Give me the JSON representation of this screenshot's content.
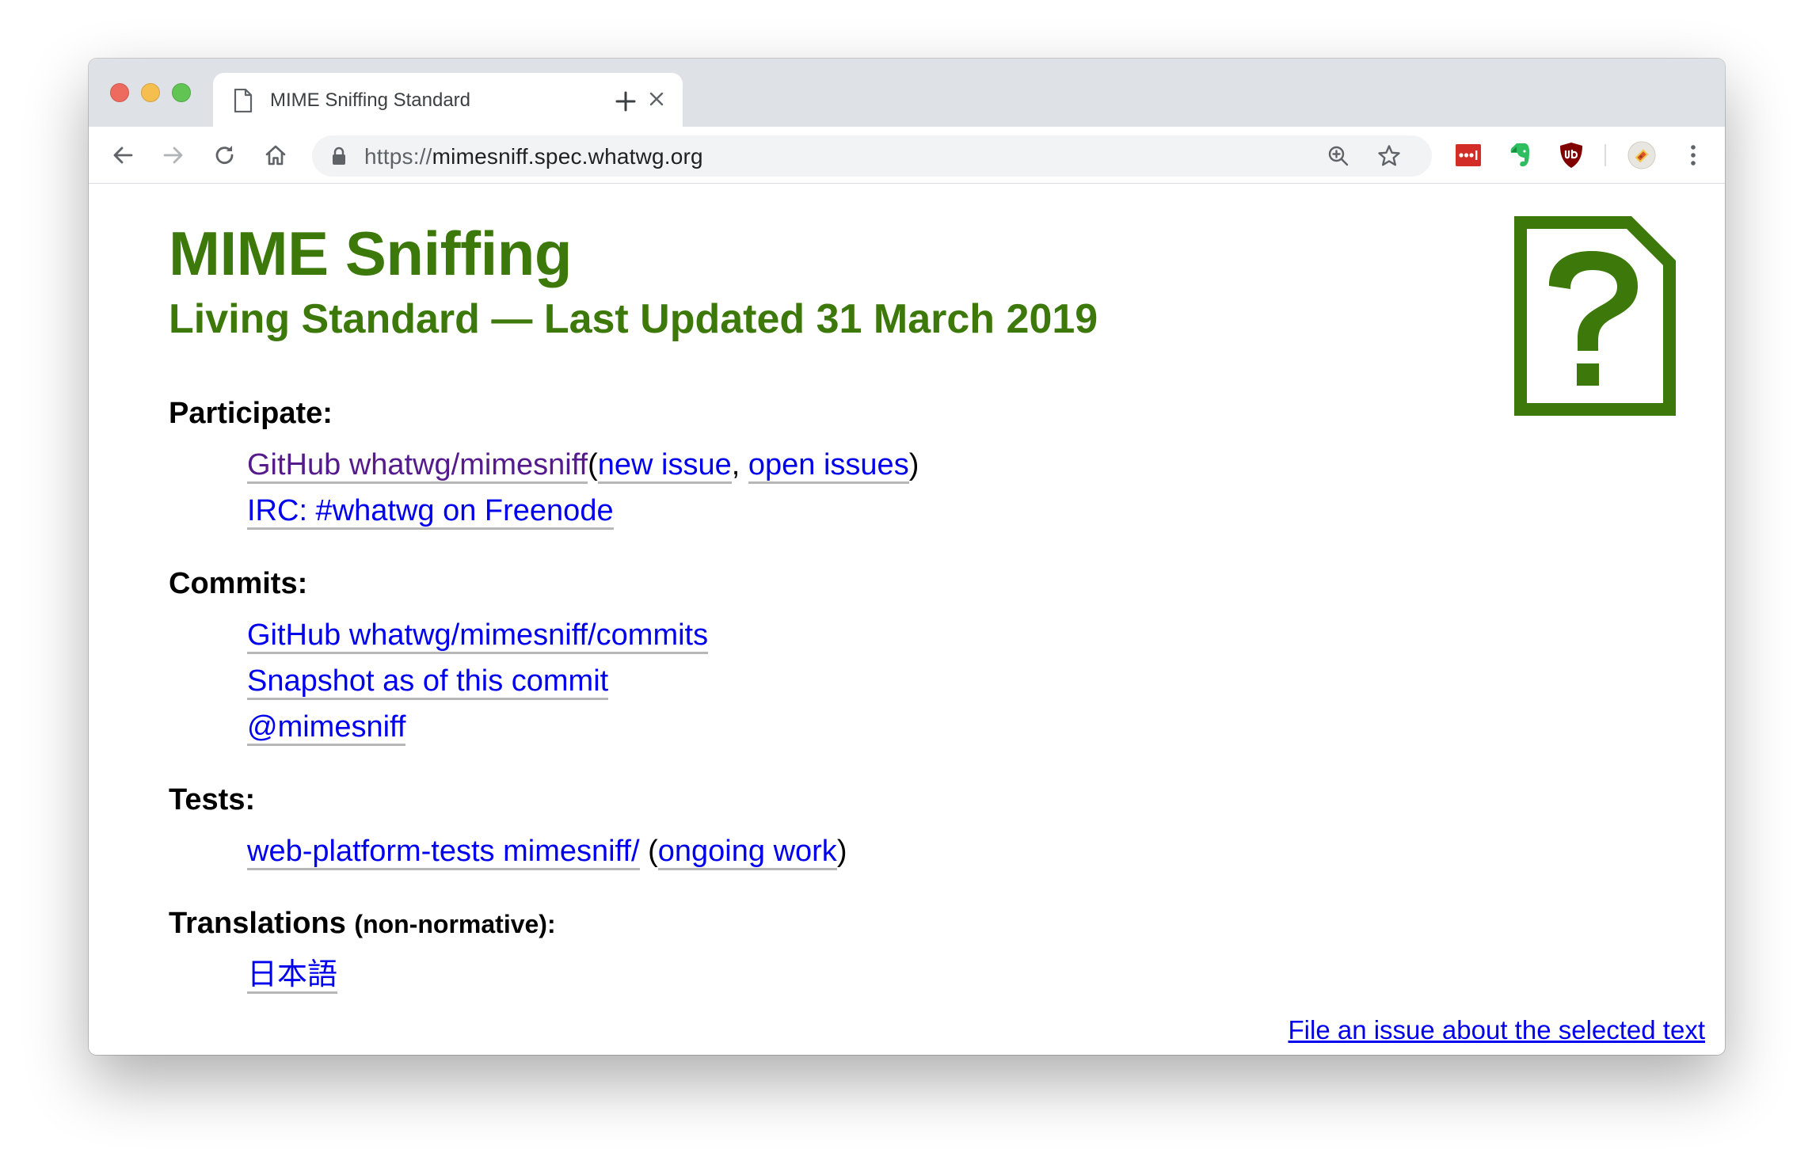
{
  "browser": {
    "tab": {
      "title": "MIME Sniffing Standard"
    },
    "address_bar": {
      "scheme": "https://",
      "host": "mimesniff.spec.whatwg.org"
    },
    "colors": {
      "tabstrip": "#dee1e6",
      "lastpass": "#d32d27",
      "evernote": "#2dbe60",
      "ublock": "#800000"
    }
  },
  "page": {
    "title": "MIME Sniffing",
    "subtitle": "Living Standard — Last Updated 31 March 2019",
    "accent_color": "#3c790a",
    "participate": {
      "heading": "Participate:",
      "github": "GitHub whatwg/mimesniff",
      "open_paren": "(",
      "new_issue": "new issue",
      "comma": ", ",
      "open_issues": "open issues",
      "close_paren": ")",
      "irc": "IRC: #whatwg on Freenode"
    },
    "commits": {
      "heading": "Commits:",
      "github_commits": "GitHub whatwg/mimesniff/commits",
      "snapshot": "Snapshot as of this commit",
      "twitter": "@mimesniff"
    },
    "tests": {
      "heading": "Tests:",
      "wpt": "web-platform-tests mimesniff/",
      "open_paren": " (",
      "ongoing": "ongoing work",
      "close_paren": ")"
    },
    "translations": {
      "heading": "Translations",
      "qualifier": "(non-normative):",
      "japanese": "日本語"
    },
    "file_issue": "File an issue about the selected text"
  }
}
